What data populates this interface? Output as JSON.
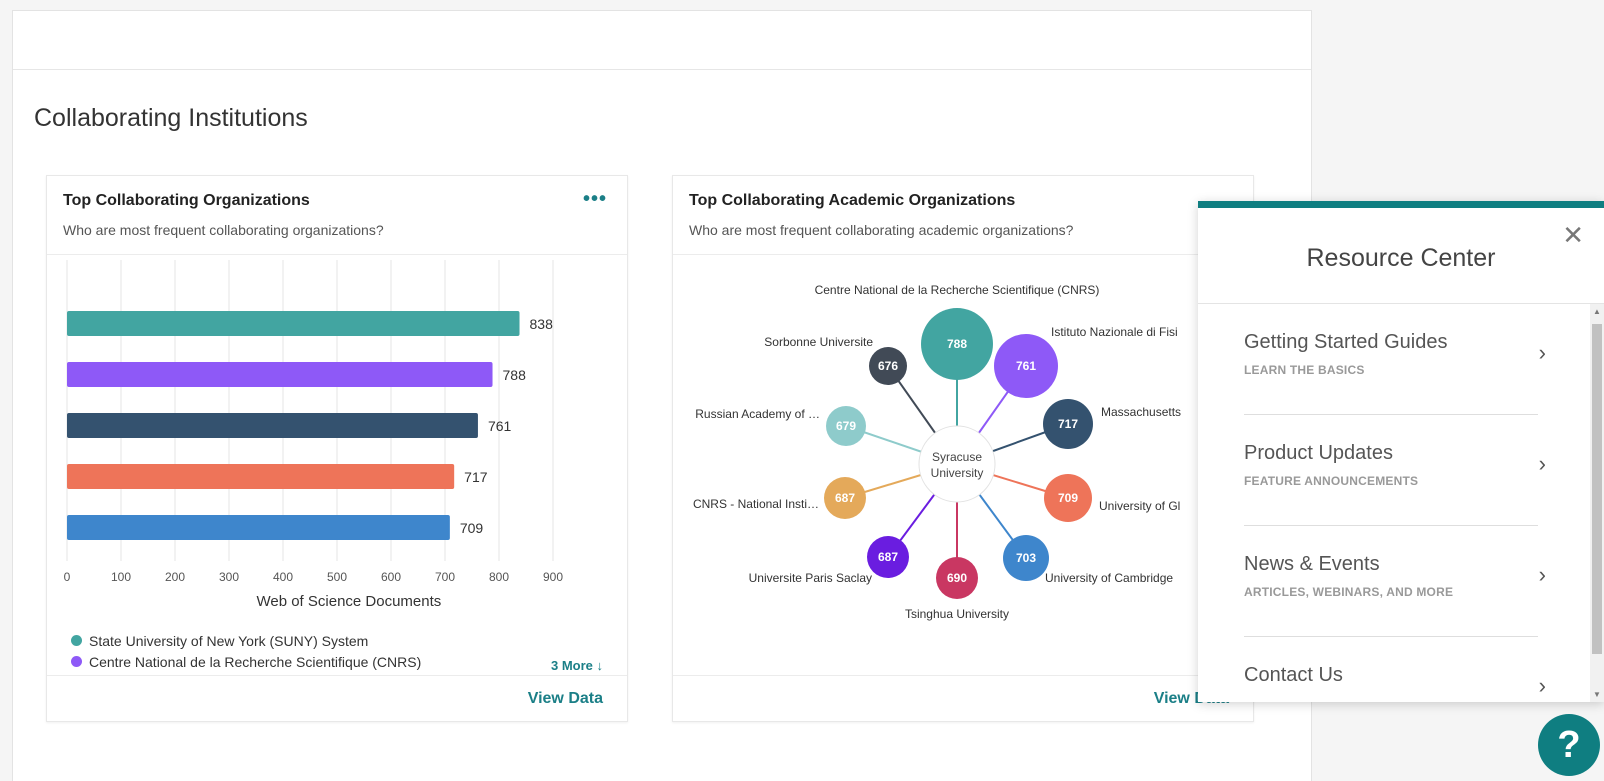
{
  "section": {
    "title": "Collaborating Institutions"
  },
  "card1": {
    "title": "Top Collaborating Organizations",
    "subtitle": "Who are most frequent collaborating organizations?",
    "more_icon": "ellipsis-icon",
    "view_data": "View Data",
    "legend": [
      {
        "label": "State University of New York (SUNY) System",
        "color": "#42a5a1"
      },
      {
        "label": "Centre National de la Recherche Scientifique (CNRS)",
        "color": "#8e59f7"
      }
    ],
    "legend_more": "3 More ↓"
  },
  "card2": {
    "title": "Top Collaborating Academic Organizations",
    "subtitle": "Who are most frequent collaborating academic organizations?",
    "view_data": "View Data"
  },
  "chart_data": [
    {
      "type": "bar",
      "orientation": "horizontal",
      "xlabel": "Web of Science Documents",
      "xlim": [
        0,
        900
      ],
      "xticks": [
        0,
        100,
        200,
        300,
        400,
        500,
        600,
        700,
        800,
        900
      ],
      "values": [
        838,
        788,
        761,
        717,
        709
      ],
      "colors": [
        "#42a5a1",
        "#8e59f7",
        "#34526f",
        "#ee7459",
        "#3e86cc"
      ],
      "grid": true
    },
    {
      "type": "network",
      "center": "Syracuse University",
      "nodes": [
        {
          "label": "Centre National de la Recherche Scientifique (CNRS)",
          "value": 788,
          "color": "#42a5a1"
        },
        {
          "label": "Istituto Nazionale di Fisi",
          "value": 761,
          "color": "#8e59f7"
        },
        {
          "label": "Massachusetts",
          "value": 717,
          "color": "#34526f"
        },
        {
          "label": "University of Gl",
          "value": 709,
          "color": "#ee7459"
        },
        {
          "label": "University of Cambridge",
          "value": 703,
          "color": "#3e86cc"
        },
        {
          "label": "Tsinghua University",
          "value": 690,
          "color": "#c93762"
        },
        {
          "label": "Universite Paris Saclay",
          "value": 687,
          "color": "#6a1de0"
        },
        {
          "label": "CNRS - National Insti…",
          "value": 687,
          "color": "#e4a95a"
        },
        {
          "label": "Russian Academy of …",
          "value": 679,
          "color": "#8ecbcb"
        },
        {
          "label": "Sorbonne Universite",
          "value": 676,
          "color": "#414a56"
        }
      ]
    }
  ],
  "resource_center": {
    "title": "Resource Center",
    "close_icon": "close-icon",
    "items": [
      {
        "title": "Getting Started Guides",
        "subtitle": "LEARN THE BASICS"
      },
      {
        "title": "Product Updates",
        "subtitle": "FEATURE ANNOUNCEMENTS"
      },
      {
        "title": "News & Events",
        "subtitle": "ARTICLES, WEBINARS, AND MORE"
      },
      {
        "title": "Contact Us",
        "subtitle": ""
      }
    ]
  },
  "help_button": {
    "label": "?"
  }
}
